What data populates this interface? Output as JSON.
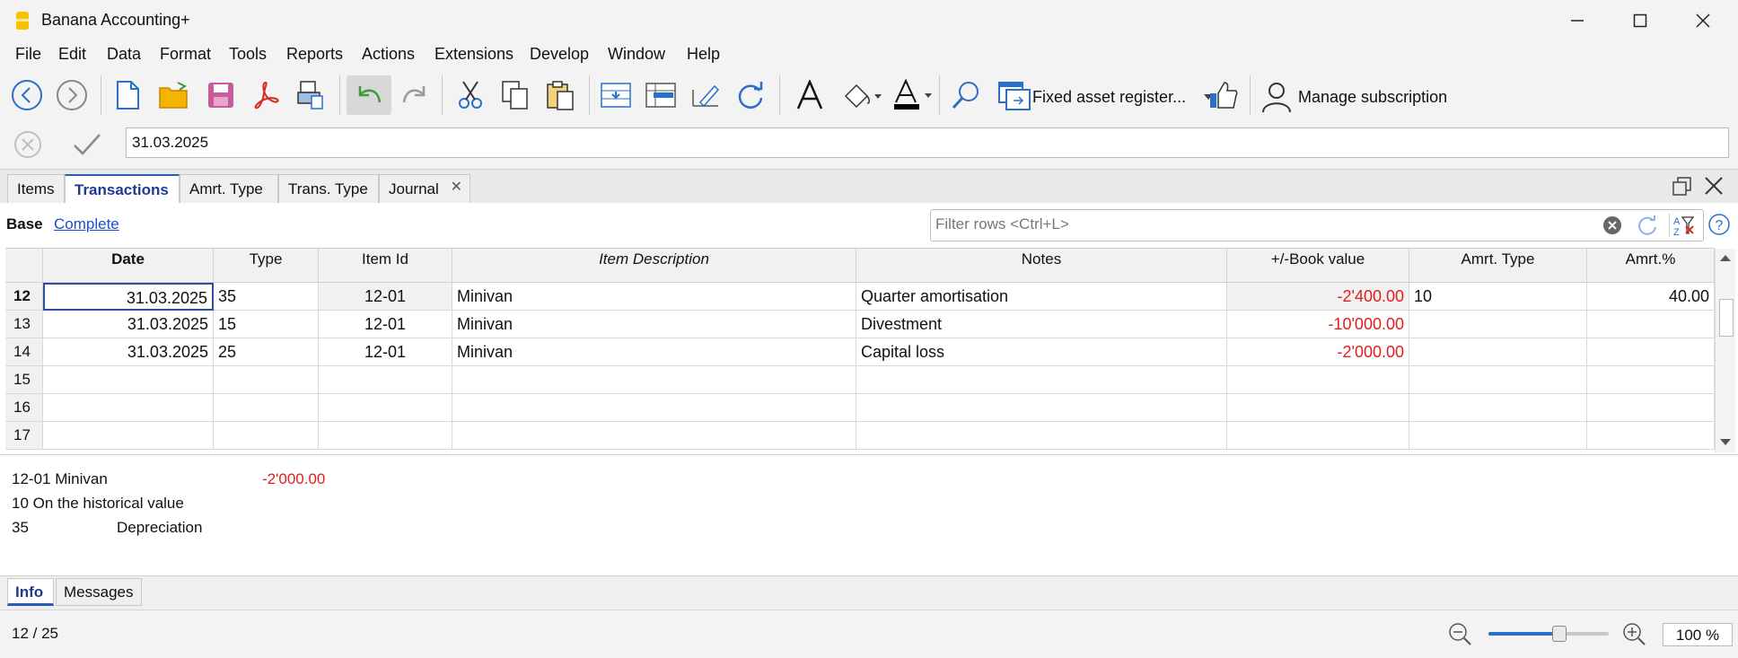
{
  "window": {
    "title": "Banana Accounting+"
  },
  "menu": [
    "File",
    "Edit",
    "Data",
    "Format",
    "Tools",
    "Reports",
    "Actions",
    "Extensions",
    "Develop",
    "Window",
    "Help"
  ],
  "toolbar": {
    "report_selector": "Fixed asset register...",
    "manage_subscription": "Manage subscription"
  },
  "edit_line": {
    "value": "31.03.2025"
  },
  "tabs": [
    "Items",
    "Transactions",
    "Amrt. Type",
    "Trans. Type",
    "Journal"
  ],
  "views": {
    "base": "Base",
    "complete": "Complete"
  },
  "filter": {
    "placeholder": "Filter rows <Ctrl+L>"
  },
  "table": {
    "columns": [
      "Date",
      "Type",
      "Item Id",
      "Item Description",
      "Notes",
      "+/-Book value",
      "Amrt. Type",
      "Amrt.%"
    ],
    "rows": [
      {
        "no": "12",
        "date": "31.03.2025",
        "type": "35",
        "item_id": "12-01",
        "description": "Minivan",
        "notes": "Quarter amortisation",
        "book_value": "-2'400.00",
        "amrt_type": "10",
        "amrt_pct": "40.00"
      },
      {
        "no": "13",
        "date": "31.03.2025",
        "type": "15",
        "item_id": "12-01",
        "description": "Minivan",
        "notes": "Divestment",
        "book_value": "-10'000.00",
        "amrt_type": "",
        "amrt_pct": ""
      },
      {
        "no": "14",
        "date": "31.03.2025",
        "type": "25",
        "item_id": "12-01",
        "description": "Minivan",
        "notes": "Capital loss",
        "book_value": "-2'000.00",
        "amrt_type": "",
        "amrt_pct": ""
      },
      {
        "no": "15",
        "date": "",
        "type": "",
        "item_id": "",
        "description": "",
        "notes": "",
        "book_value": "",
        "amrt_type": "",
        "amrt_pct": ""
      },
      {
        "no": "16",
        "date": "",
        "type": "",
        "item_id": "",
        "description": "",
        "notes": "",
        "book_value": "",
        "amrt_type": "",
        "amrt_pct": ""
      },
      {
        "no": "17",
        "date": "",
        "type": "",
        "item_id": "",
        "description": "",
        "notes": "",
        "book_value": "",
        "amrt_type": "",
        "amrt_pct": ""
      }
    ]
  },
  "info": {
    "line1_label": "12-01 Minivan",
    "line1_value": "-2'000.00",
    "line2": "10 On the historical value",
    "line3_code": "35",
    "line3_text": "Depreciation"
  },
  "bottom_tabs": [
    "Info",
    "Messages"
  ],
  "status": {
    "position": "12 / 25",
    "zoom": "100 %",
    "zoom_level": 0.6
  },
  "colors": {
    "negative": "#e0201c",
    "accent": "#2a5db0"
  }
}
